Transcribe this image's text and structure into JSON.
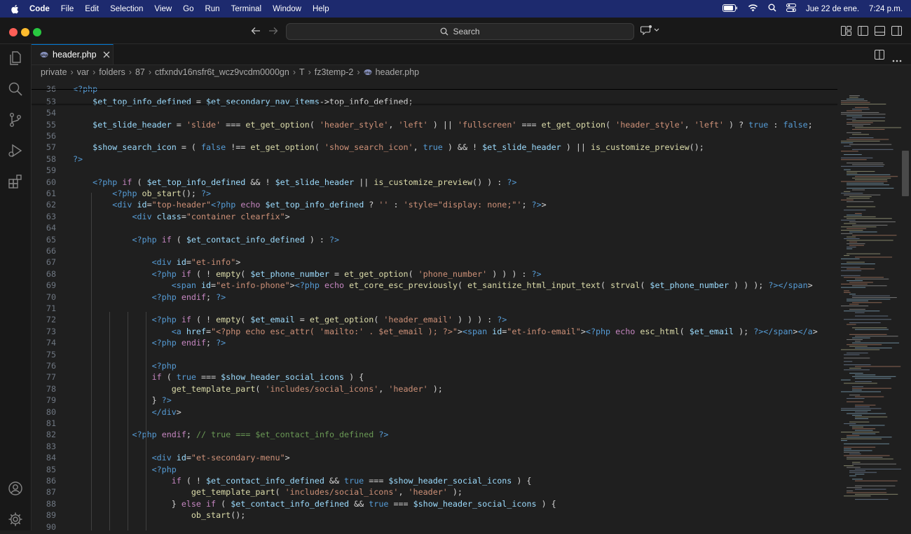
{
  "menubar": {
    "app": "Code",
    "items": [
      "File",
      "Edit",
      "Selection",
      "View",
      "Go",
      "Run",
      "Terminal",
      "Window",
      "Help"
    ],
    "date": "Jue 22 de ene.",
    "time": "7:24 p.m."
  },
  "titlebar": {
    "search_placeholder": "Search"
  },
  "tab": {
    "label": "header.php"
  },
  "breadcrumb": [
    "private",
    "var",
    "folders",
    "87",
    "ctfxndv16nsfr6t_wcz9vcdm0000gn",
    "T",
    "fz3temp-2",
    "header.php"
  ],
  "code_lines": [
    {
      "n": "36",
      "t": "<?php"
    },
    {
      "n": "53",
      "t": "    $et_top_info_defined = $et_secondary_nav_items->top_info_defined;"
    },
    {
      "n": "54",
      "t": ""
    },
    {
      "n": "55",
      "t": "    $et_slide_header = 'slide' === et_get_option( 'header_style', 'left' ) || 'fullscreen' === et_get_option( 'header_style', 'left' ) ? true : false;"
    },
    {
      "n": "56",
      "t": ""
    },
    {
      "n": "57",
      "t": "    $show_search_icon = ( false !== et_get_option( 'show_search_icon', true ) && ! $et_slide_header ) || is_customize_preview();"
    },
    {
      "n": "58",
      "t": "?>"
    },
    {
      "n": "59",
      "t": ""
    },
    {
      "n": "60",
      "t": "    <?php if ( $et_top_info_defined && ! $et_slide_header || is_customize_preview() ) : ?>"
    },
    {
      "n": "61",
      "t": "        <?php ob_start(); ?>"
    },
    {
      "n": "62",
      "t": "        <div id=\"top-header\"<?php echo $et_top_info_defined ? '' : 'style=\"display: none;\"'; ?>>"
    },
    {
      "n": "63",
      "t": "            <div class=\"container clearfix\">"
    },
    {
      "n": "64",
      "t": ""
    },
    {
      "n": "65",
      "t": "            <?php if ( $et_contact_info_defined ) : ?>"
    },
    {
      "n": "66",
      "t": ""
    },
    {
      "n": "67",
      "t": "                <div id=\"et-info\">"
    },
    {
      "n": "68",
      "t": "                <?php if ( ! empty( $et_phone_number = et_get_option( 'phone_number' ) ) ) : ?>"
    },
    {
      "n": "69",
      "t": "                    <span id=\"et-info-phone\"><?php echo et_core_esc_previously( et_sanitize_html_input_text( strval( $et_phone_number ) ) ); ?></span>"
    },
    {
      "n": "70",
      "t": "                <?php endif; ?>"
    },
    {
      "n": "71",
      "t": ""
    },
    {
      "n": "72",
      "t": "                <?php if ( ! empty( $et_email = et_get_option( 'header_email' ) ) ) : ?>"
    },
    {
      "n": "73",
      "t": "                    <a href=\"<?php echo esc_attr( 'mailto:' . $et_email ); ?>\"><span id=\"et-info-email\"><?php echo esc_html( $et_email ); ?></span></a>"
    },
    {
      "n": "74",
      "t": "                <?php endif; ?>"
    },
    {
      "n": "75",
      "t": ""
    },
    {
      "n": "76",
      "t": "                <?php"
    },
    {
      "n": "77",
      "t": "                if ( true === $show_header_social_icons ) {"
    },
    {
      "n": "78",
      "t": "                    get_template_part( 'includes/social_icons', 'header' );"
    },
    {
      "n": "79",
      "t": "                } ?>"
    },
    {
      "n": "80",
      "t": "                </div>"
    },
    {
      "n": "81",
      "t": ""
    },
    {
      "n": "82",
      "t": "            <?php endif; // true === $et_contact_info_defined ?>"
    },
    {
      "n": "83",
      "t": ""
    },
    {
      "n": "84",
      "t": "                <div id=\"et-secondary-menu\">"
    },
    {
      "n": "85",
      "t": "                <?php"
    },
    {
      "n": "86",
      "t": "                    if ( ! $et_contact_info_defined && true === $show_header_social_icons ) {"
    },
    {
      "n": "87",
      "t": "                        get_template_part( 'includes/social_icons', 'header' );"
    },
    {
      "n": "88",
      "t": "                    } else if ( $et_contact_info_defined && true === $show_header_social_icons ) {"
    },
    {
      "n": "89",
      "t": "                        ob_start();"
    },
    {
      "n": "90",
      "t": ""
    }
  ]
}
